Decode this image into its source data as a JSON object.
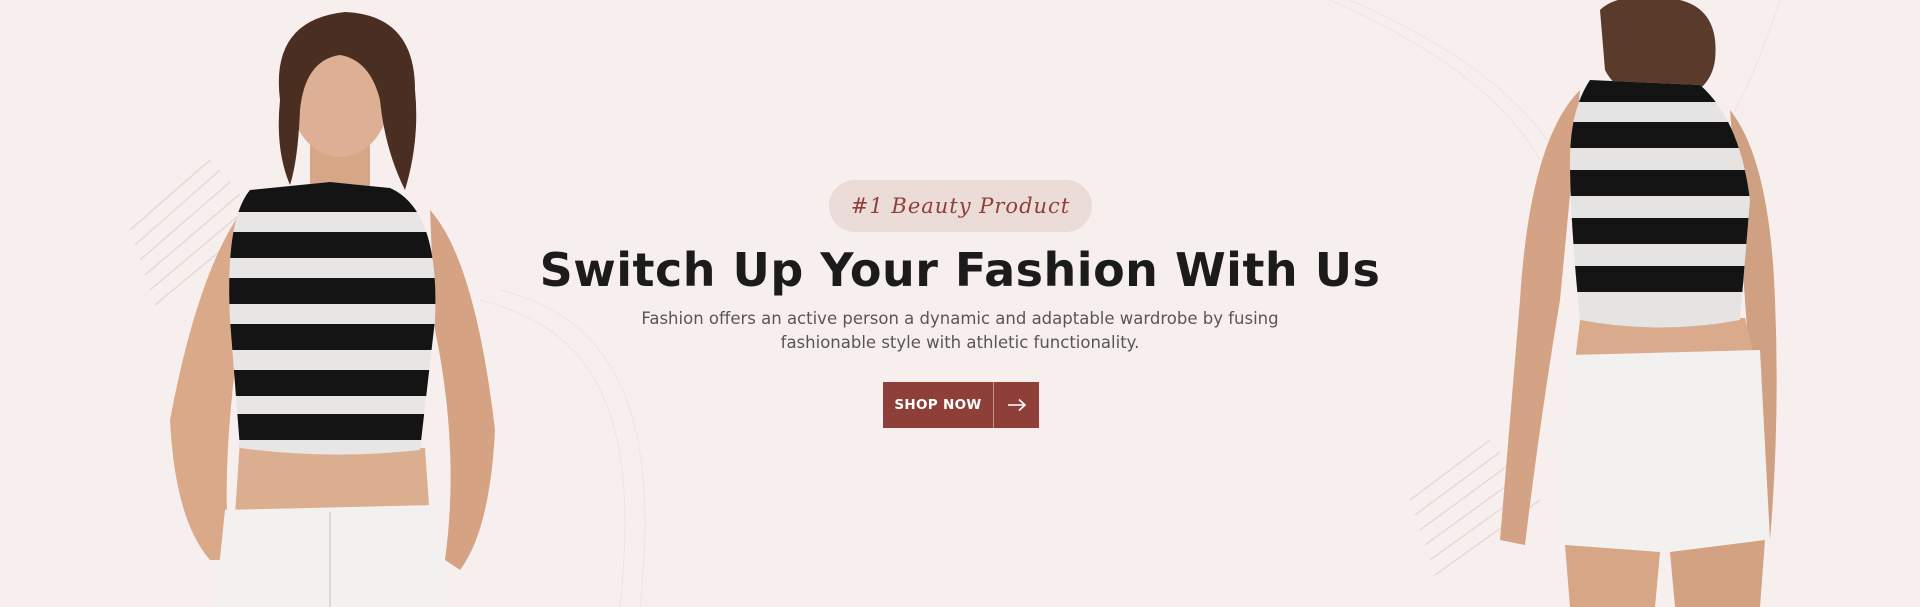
{
  "hero": {
    "badge": "#1 Beauty Product",
    "headline": "Switch Up Your Fashion With Us",
    "subtext_line1": "Fashion offers an active person a dynamic and adaptable wardrobe by fusing",
    "subtext_line2": "fashionable style with athletic functionality.",
    "button_label": "SHOP NOW",
    "button_icon": "arrow-right-icon"
  },
  "colors": {
    "background": "#f7efee",
    "accent": "#8e3f38",
    "badge_bg": "#ecdcd7",
    "headline": "#1c1b1b",
    "body_text": "#5a5555"
  },
  "images": {
    "left": "model-front-striped-crop-top",
    "right": "model-back-striped-crop-top"
  }
}
